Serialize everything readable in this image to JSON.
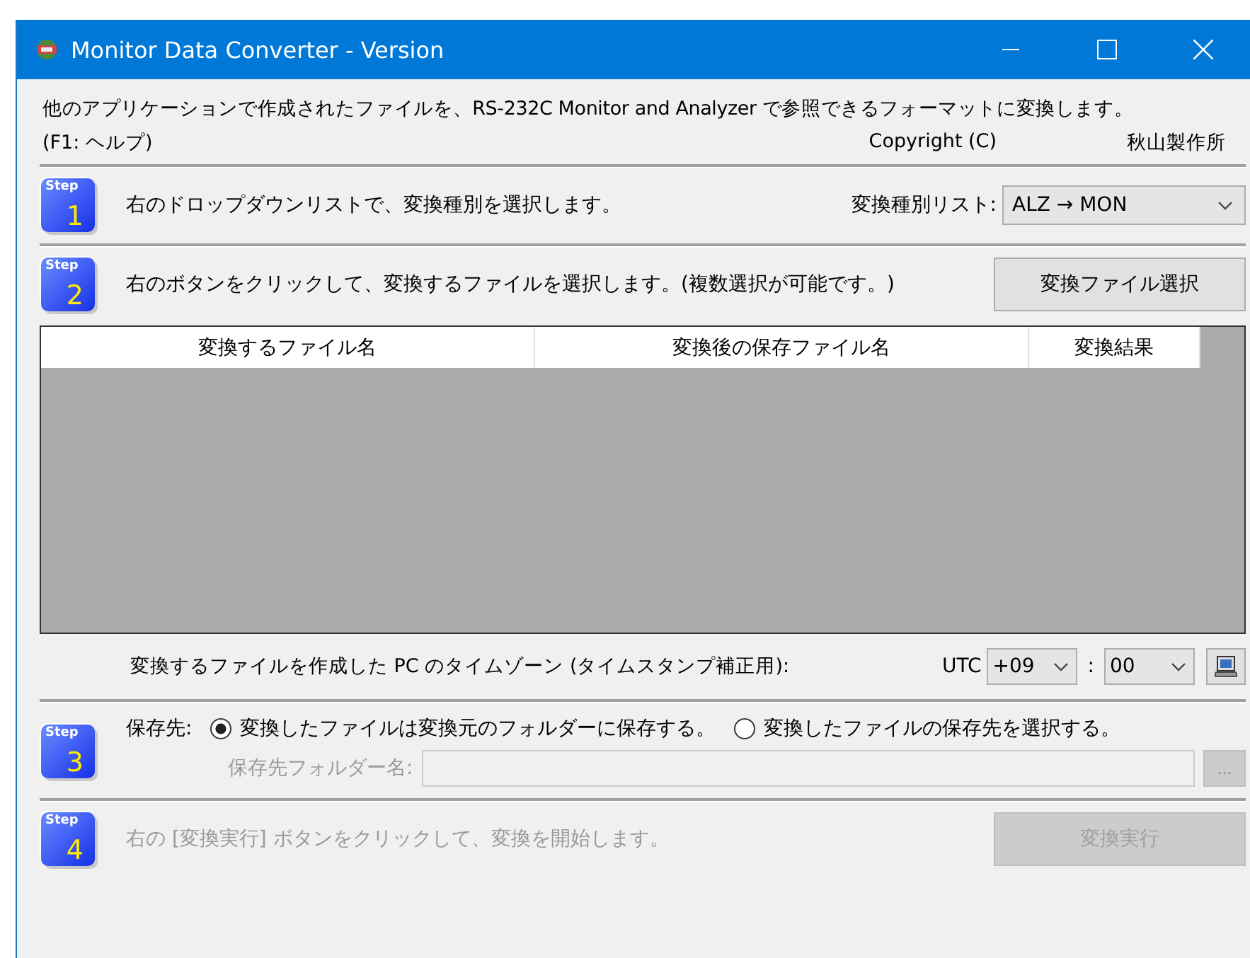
{
  "window": {
    "title": "Monitor Data Converter - Version"
  },
  "header": {
    "description": "他のアプリケーションで作成されたファイルを、RS-232C Monitor and Analyzer で参照できるフォーマットに変換します。",
    "help_hint": "(F1: ヘルプ)",
    "copyright": "Copyright (C)",
    "company": "秋山製作所"
  },
  "step1": {
    "badge": {
      "label": "Step",
      "number": "1"
    },
    "instruction": "右のドロップダウンリストで、変換種別を選択します。",
    "dropdown": {
      "label": "変換種別リスト:",
      "value": "ALZ → MON"
    }
  },
  "step2": {
    "badge": {
      "label": "Step",
      "number": "2"
    },
    "instruction": "右のボタンをクリックして、変換するファイルを選択します。(複数選択が可能です。)",
    "button": {
      "label": "変換ファイル選択"
    },
    "table": {
      "columns": [
        "変換するファイル名",
        "変換後の保存ファイル名",
        "変換結果"
      ]
    },
    "timezone": {
      "label": "変換するファイルを作成した PC のタイムゾーン (タイムスタンプ補正用):",
      "prefix": "UTC",
      "hours": "+09",
      "separator": ":",
      "minutes": "00"
    }
  },
  "step3": {
    "badge": {
      "label": "Step",
      "number": "3"
    },
    "label": "保存先:",
    "options": [
      {
        "label": "変換したファイルは変換元のフォルダーに保存する。",
        "selected": true
      },
      {
        "label": "変換したファイルの保存先を選択する。",
        "selected": false
      }
    ],
    "folder_field": {
      "label": "保存先フォルダー名:",
      "disabled": true
    },
    "browse_button": {
      "label": "...",
      "disabled": true
    }
  },
  "step4": {
    "badge": {
      "label": "Step",
      "number": "4"
    },
    "instruction": "右の [変換実行] ボタンをクリックして、変換を開始します。",
    "disabled": true,
    "button": {
      "label": "変換実行",
      "disabled": true
    }
  }
}
